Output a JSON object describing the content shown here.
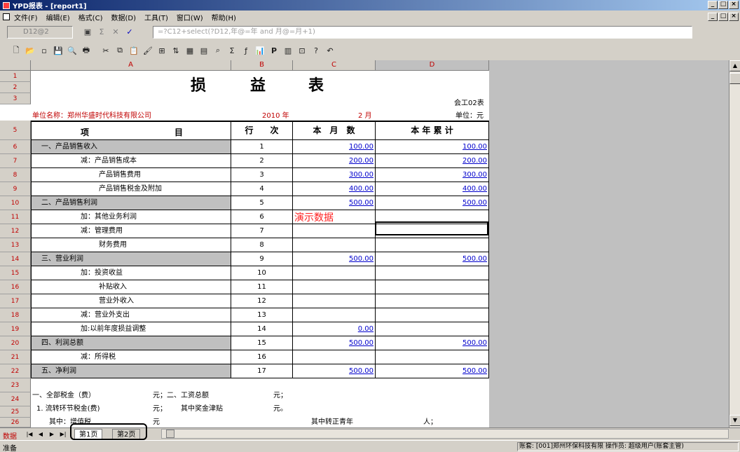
{
  "window": {
    "title": "YPD报表 - [report1]"
  },
  "menu": [
    "文件(F)",
    "编辑(E)",
    "格式(C)",
    "数据(D)",
    "工具(T)",
    "窗口(W)",
    "帮助(H)"
  ],
  "formula_bar": {
    "cell_ref": "D12@2",
    "formula": "=?C12+select(?D12,年@=年 and 月@=月+1)"
  },
  "columns": [
    "A",
    "B",
    "C",
    "D"
  ],
  "row_numbers": [
    "1",
    "2",
    "3",
    "5",
    "6",
    "7",
    "8",
    "9",
    "10",
    "11",
    "12",
    "13",
    "14",
    "15",
    "16",
    "17",
    "18",
    "19",
    "20",
    "21",
    "22",
    "23",
    "24",
    "25",
    "26"
  ],
  "report": {
    "title_chars": [
      "损",
      "益",
      "表"
    ],
    "form_no": "会工02表",
    "unit": "单位：元",
    "company": "单位名称：郑州华盛时代科技有限公司",
    "year": "2010 年",
    "month": "2 月",
    "header": {
      "item": "项",
      "item2": "目",
      "line": "行　　次",
      "month": "本　月　数",
      "year": "本 年 累 计"
    },
    "demo_label": "演示数据",
    "rows": [
      {
        "item": "一、产品销售收入",
        "line": "1",
        "month": "100.00",
        "year": "100.00",
        "shade": true
      },
      {
        "item": "减：产品销售成本",
        "line": "2",
        "month": "200.00",
        "year": "200.00"
      },
      {
        "item": "产品销售费用",
        "line": "3",
        "month": "300.00",
        "year": "300.00"
      },
      {
        "item": "产品销售税金及附加",
        "line": "4",
        "month": "400.00",
        "year": "400.00"
      },
      {
        "item": "二、产品销售利润",
        "line": "5",
        "month": "500.00",
        "year": "500.00",
        "shade": true
      },
      {
        "item": "加：其他业务利润",
        "line": "6",
        "month": "",
        "year": ""
      },
      {
        "item": "减：管理费用",
        "line": "7",
        "month": "",
        "year": ""
      },
      {
        "item": "财务费用",
        "line": "8",
        "month": "",
        "year": ""
      },
      {
        "item": "三、营业利润",
        "line": "9",
        "month": "500.00",
        "year": "500.00",
        "shade": true
      },
      {
        "item": "加：投资收益",
        "line": "10",
        "month": "",
        "year": ""
      },
      {
        "item": "补贴收入",
        "line": "11",
        "month": "",
        "year": ""
      },
      {
        "item": "营业外收入",
        "line": "12",
        "month": "",
        "year": ""
      },
      {
        "item": "减：营业外支出",
        "line": "13",
        "month": "",
        "year": ""
      },
      {
        "item": "加:以前年度损益调整",
        "line": "14",
        "month": "0.00",
        "year": ""
      },
      {
        "item": "四、利润总额",
        "line": "15",
        "month": "500.00",
        "year": "500.00",
        "shade": true
      },
      {
        "item": "减：所得税",
        "line": "16",
        "month": "",
        "year": ""
      },
      {
        "item": "五、净利润",
        "line": "17",
        "month": "500.00",
        "year": "500.00",
        "shade": true
      }
    ],
    "footer": {
      "r24_a": "一、全部税金（费）",
      "r24_b": "元；二、工资总额",
      "r24_c": "元；",
      "r25_a": "1. 流转环节税金(费)",
      "r25_b": "元；",
      "r25_c": "其中奖金津贴",
      "r25_d": "元。",
      "r26_a": "其中：增值税",
      "r26_b": "元",
      "r26_c": "其中转正青年",
      "r26_d": "人；"
    }
  },
  "tabs": {
    "label": "数据",
    "items": [
      "第1页",
      "第2页"
    ]
  },
  "status": {
    "left": "准备",
    "right": "账套: [001]郑州环保科技有限 操作员: 超级用户(账套主管)"
  }
}
